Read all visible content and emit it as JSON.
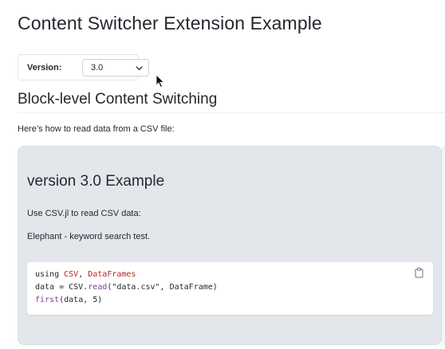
{
  "page": {
    "title": "Content Switcher Extension Example"
  },
  "version_selector": {
    "label": "Version:",
    "selected": "3.0"
  },
  "section": {
    "title": "Block-level Content Switching",
    "intro": "Here’s how to read data from a CSV file:"
  },
  "panel": {
    "title": "version 3.0 Example",
    "p1": "Use CSV.jl to read CSV data:",
    "p2": "Elephant - keyword search test."
  },
  "code": {
    "l1_kw": "using ",
    "l1_mod1": "CSV",
    "l1_sep": ", ",
    "l1_mod2": "DataFrames",
    "l2_a": "data = CSV.",
    "l2_fn": "read",
    "l2_b": "(\"data.csv\", DataFrame)",
    "l3_fn": "first",
    "l3_b": "(data, 5)"
  },
  "icons": {
    "dropdown": "chevron-down-icon",
    "copy": "copy-icon",
    "cursor": "mouse-pointer-icon"
  }
}
